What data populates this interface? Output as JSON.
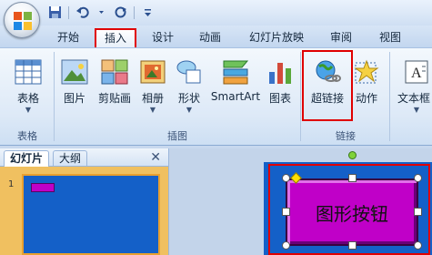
{
  "quick_access": {
    "save_icon": "save-icon",
    "undo_icon": "undo-icon",
    "redo_icon": "redo-icon",
    "customize_icon": "customize-qat-icon"
  },
  "tabs": [
    {
      "label": "开始",
      "active": false
    },
    {
      "label": "插入",
      "active": true
    },
    {
      "label": "设计",
      "active": false
    },
    {
      "label": "动画",
      "active": false
    },
    {
      "label": "幻灯片放映",
      "active": false
    },
    {
      "label": "审阅",
      "active": false
    },
    {
      "label": "视图",
      "active": false
    }
  ],
  "ribbon": {
    "table_group": {
      "label": "表格",
      "buttons": [
        {
          "label": "表格",
          "icon": "table-icon",
          "dropdown": true
        }
      ]
    },
    "illustrations_group": {
      "label": "插图",
      "buttons": [
        {
          "label": "图片",
          "icon": "picture-icon"
        },
        {
          "label": "剪贴画",
          "icon": "clipart-icon"
        },
        {
          "label": "相册",
          "icon": "photo-album-icon",
          "dropdown": true
        },
        {
          "label": "形状",
          "icon": "shapes-icon",
          "dropdown": true
        },
        {
          "label": "SmartArt",
          "icon": "smartart-icon"
        },
        {
          "label": "图表",
          "icon": "chart-icon"
        }
      ]
    },
    "links_group": {
      "label": "链接",
      "buttons": [
        {
          "label": "超链接",
          "icon": "hyperlink-icon",
          "highlighted": true
        },
        {
          "label": "动作",
          "icon": "action-icon"
        }
      ]
    },
    "text_group": {
      "buttons": [
        {
          "label": "文本框",
          "icon": "textbox-icon",
          "dropdown": true
        }
      ]
    }
  },
  "left_pane": {
    "tabs": [
      {
        "label": "幻灯片",
        "active": true
      },
      {
        "label": "大纲",
        "active": false
      }
    ],
    "close_glyph": "✕",
    "slide_number": "1"
  },
  "slide": {
    "action_button_text": "图形按钮",
    "action_button_color": "#c000c8",
    "slide_background": "#1460c8",
    "selection_highlight": "#e00000"
  },
  "colors": {
    "ribbon_bg": "#dde9f7",
    "highlight_red": "#e00000",
    "pane_orange": "#f0c060"
  }
}
